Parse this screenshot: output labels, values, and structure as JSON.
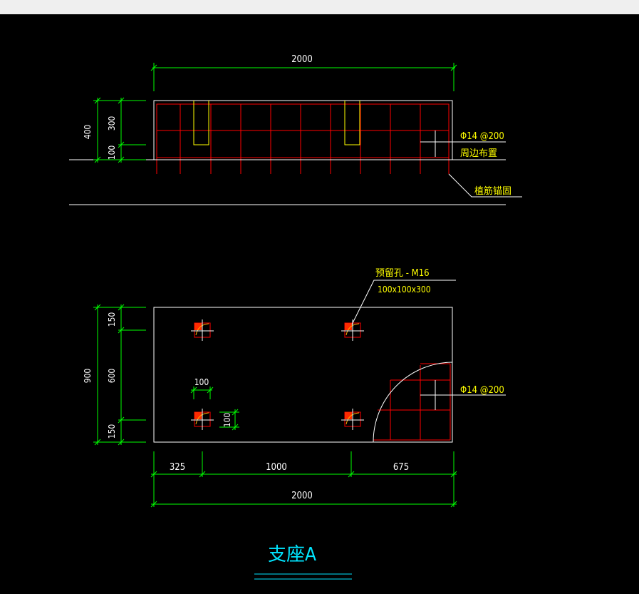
{
  "colors": {
    "background": "#000000",
    "dimension": "#00ff00",
    "outline": "#ffffff",
    "rebar": "#ff0000",
    "annotation": "#ffff00",
    "title": "#00e5ff",
    "anchor_fill": "#ff2a00",
    "anchor_mark": "#ffaa00"
  },
  "elevation": {
    "dim_width": "2000",
    "dim_height_total": "400",
    "dim_height_upper": "300",
    "dim_height_lower": "100",
    "rebar_spec": "Φ14 @200",
    "rebar_note": "周边布置",
    "anchor_note": "植筋锚固"
  },
  "plan": {
    "hole_note": "预留孔 - M16",
    "hole_size": "100x100x300",
    "rebar_spec": "Φ14 @200",
    "dim_total_height": "900",
    "dim_top": "150",
    "dim_mid": "600",
    "dim_bottom": "150",
    "dim_hole_width": "100",
    "dim_hole_height": "100",
    "dim_left": "325",
    "dim_middle": "1000",
    "dim_right": "675",
    "dim_total_width": "2000"
  },
  "title": "支座A"
}
